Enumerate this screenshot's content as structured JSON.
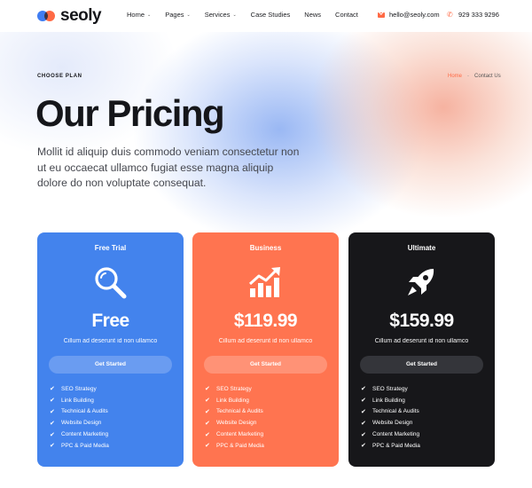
{
  "brand": {
    "name": "seoly"
  },
  "nav": {
    "items": [
      {
        "label": "Home",
        "has_dropdown": true
      },
      {
        "label": "Pages",
        "has_dropdown": true
      },
      {
        "label": "Services",
        "has_dropdown": true
      },
      {
        "label": "Case Studies",
        "has_dropdown": false
      },
      {
        "label": "News",
        "has_dropdown": false
      },
      {
        "label": "Contact",
        "has_dropdown": false
      }
    ],
    "chevron": "⌄"
  },
  "contact": {
    "email": "hello@seoly.com",
    "email_icon": "mail-icon",
    "phone": "929 333 9296",
    "phone_icon": "phone-icon"
  },
  "hero": {
    "eyebrow": "CHOOSE PLAN",
    "breadcrumb": {
      "home": "Home",
      "separator": "-",
      "current": "Contact Us"
    },
    "title": "Our Pricing",
    "text": "Mollit id aliquip duis commodo veniam consectetur non ut eu occaecat ullamco fugiat esse magna aliquip dolore do non voluptate consequat."
  },
  "plans": [
    {
      "name": "Free Trial",
      "icon": "magnifier-icon",
      "price": "Free",
      "description": "Cillum ad deserunt id non ullamco",
      "button": "Get Started",
      "color": "#4383ed",
      "features": [
        "SEO Strategy",
        "Link Building",
        "Technical & Audits",
        "Website Design",
        "Content Marketing",
        "PPC & Paid Media"
      ]
    },
    {
      "name": "Business",
      "icon": "growth-chart-icon",
      "price": "$119.99",
      "description": "Cillum ad deserunt id non ullamco",
      "button": "Get Started",
      "color": "#ff7450",
      "features": [
        "SEO Strategy",
        "Link Building",
        "Technical & Audits",
        "Website Design",
        "Content Marketing",
        "PPC & Paid Media"
      ]
    },
    {
      "name": "Ultimate",
      "icon": "rocket-icon",
      "price": "$159.99",
      "description": "Cillum ad deserunt id non ullamco",
      "button": "Get Started",
      "color": "#17171a",
      "features": [
        "SEO Strategy",
        "Link Building",
        "Technical & Audits",
        "Website Design",
        "Content Marketing",
        "PPC & Paid Media"
      ]
    }
  ],
  "colors": {
    "accent": "#ff6a45",
    "blue": "#4383ed",
    "dark": "#15161a"
  }
}
